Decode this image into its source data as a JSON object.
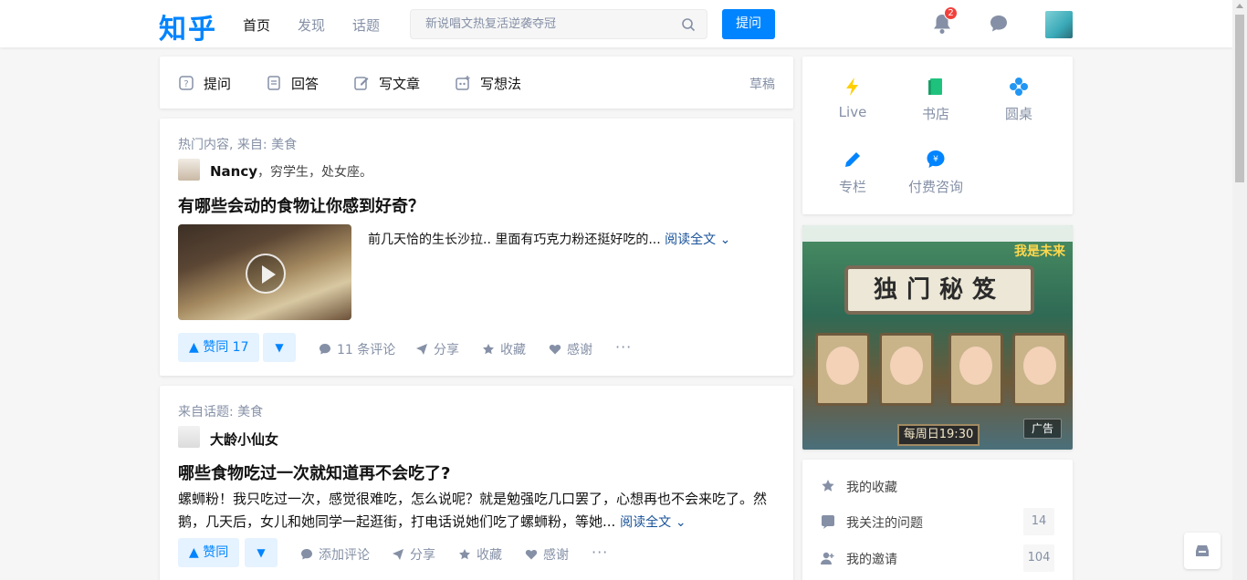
{
  "header": {
    "logo": "知乎",
    "nav": [
      "首页",
      "发现",
      "话题"
    ],
    "search_placeholder": "新说唱文热复活逆袭夺冠",
    "ask_label": "提问",
    "notification_count": "2"
  },
  "actions": {
    "items": [
      "提问",
      "回答",
      "写文章",
      "写想法"
    ],
    "draft": "草稿"
  },
  "feed": [
    {
      "source": "热门内容, 来自: 美食",
      "author": "Nancy",
      "author_bio": "，穷学生，处女座。",
      "title": "有哪些会动的食物让你感到好奇？",
      "excerpt": "前几天恰的生长沙拉.. 里面有巧克力粉还挺好吃的...",
      "read_more": "阅读全文",
      "vote_label": "赞同 17",
      "comment_label": "11 条评论",
      "share_label": "分享",
      "collect_label": "收藏",
      "thanks_label": "感谢"
    },
    {
      "source": "来自话题: 美食",
      "author": "大龄小仙女",
      "title": "哪些食物吃过一次就知道再不会吃了?",
      "excerpt": "螺蛳粉！我只吃过一次，感觉很难吃，怎么说呢？就是勉强吃几口罢了，心想再也不会来吃了。然鹅，几天后，女儿和她同学一起逛街，打电话说她们吃了螺蛳粉，等她...",
      "read_more": "阅读全文",
      "vote_label": "赞同",
      "comment_label": "添加评论",
      "share_label": "分享",
      "collect_label": "收藏",
      "thanks_label": "感谢"
    }
  ],
  "quick": [
    "Live",
    "书店",
    "圆桌",
    "专栏",
    "付费咨询"
  ],
  "ad": {
    "title": "独门秘笈",
    "brand": "我是未来",
    "time": "每周日19:30",
    "tag": "广告"
  },
  "menu": [
    {
      "label": "我的收藏",
      "count": ""
    },
    {
      "label": "我关注的问题",
      "count": "14"
    },
    {
      "label": "我的邀请",
      "count": "104"
    }
  ],
  "colors": {
    "brand": "#0084ff",
    "muted": "#8590a6",
    "badge": "#f1403c"
  }
}
